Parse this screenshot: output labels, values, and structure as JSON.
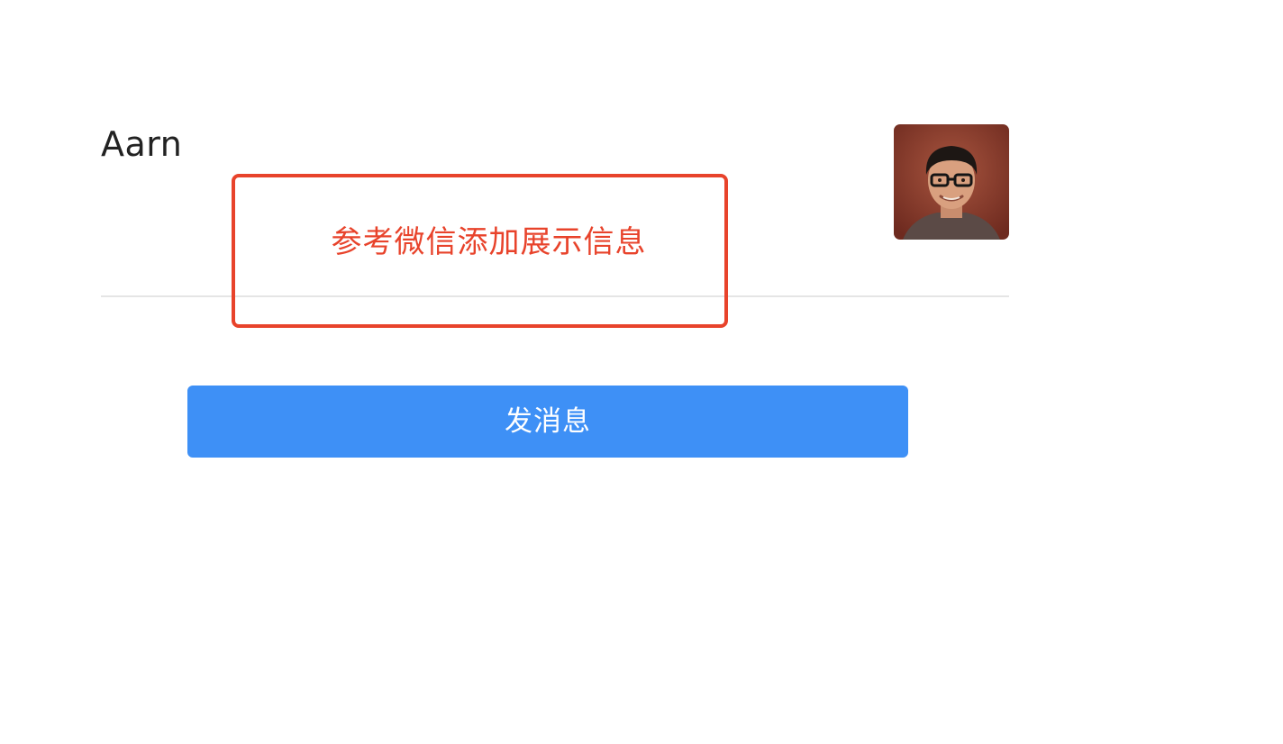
{
  "profile": {
    "name": "Aarn"
  },
  "annotation": {
    "text": "参考微信添加展示信息",
    "color": "#e8432b"
  },
  "actions": {
    "send_message_label": "发消息",
    "accent_color": "#3e90f6"
  },
  "icons": {
    "avatar": "person-photo"
  }
}
